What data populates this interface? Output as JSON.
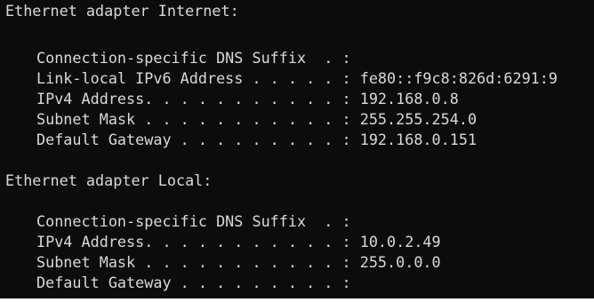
{
  "terminal": {
    "adapters": [
      {
        "header": "Ethernet adapter Internet:",
        "lines": [
          "Connection-specific DNS Suffix  . :",
          "Link-local IPv6 Address . . . . . : fe80::f9c8:826d:6291:9",
          "IPv4 Address. . . . . . . . . . . : 192.168.0.8",
          "Subnet Mask . . . . . . . . . . . : 255.255.254.0",
          "Default Gateway . . . . . . . . . : 192.168.0.151"
        ]
      },
      {
        "header": "Ethernet adapter Local:",
        "lines": [
          "Connection-specific DNS Suffix  . :",
          "IPv4 Address. . . . . . . . . . . : 10.0.2.49",
          "Subnet Mask . . . . . . . . . . . : 255.0.0.0",
          "Default Gateway . . . . . . . . . :"
        ]
      }
    ]
  },
  "colors": {
    "background": "#0c0c0c",
    "text": "#d9d9d9"
  }
}
